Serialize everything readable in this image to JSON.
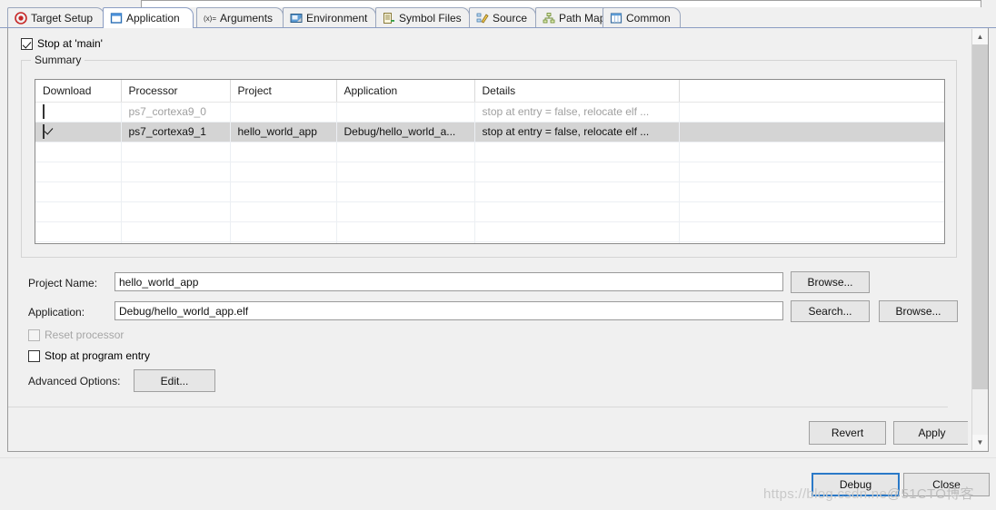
{
  "tabs": [
    {
      "label": "Target Setup",
      "icon": "target-icon",
      "active": false
    },
    {
      "label": "Application",
      "icon": "window-icon",
      "active": true
    },
    {
      "label": "Arguments",
      "icon": "variable-icon",
      "active": false
    },
    {
      "label": "Environment",
      "icon": "environment-icon",
      "active": false
    },
    {
      "label": "Symbol Files",
      "icon": "symbol-files-icon",
      "active": false
    },
    {
      "label": "Source",
      "icon": "source-icon",
      "active": false
    },
    {
      "label": "Path Map",
      "icon": "path-map-icon",
      "active": false
    },
    {
      "label": "Common",
      "icon": "common-icon",
      "active": false
    }
  ],
  "stop_at_main": {
    "label": "Stop at 'main'",
    "checked": true
  },
  "summary": {
    "title": "Summary",
    "columns": [
      "Download",
      "Processor",
      "Project",
      "Application",
      "Details",
      ""
    ],
    "rows": [
      {
        "download": false,
        "processor": "ps7_cortexa9_0",
        "project": "",
        "application": "",
        "details": "stop at entry = false, relocate elf ...",
        "enabled": false,
        "selected": false
      },
      {
        "download": true,
        "processor": "ps7_cortexa9_1",
        "project": "hello_world_app",
        "application": "Debug/hello_world_a...",
        "details": "stop at entry = false, relocate elf ...",
        "enabled": true,
        "selected": true
      }
    ],
    "empty_rows": 7
  },
  "form": {
    "project_name_label": "Project Name:",
    "project_name_value": "hello_world_app",
    "project_name_placeholder": "",
    "project_browse_label": "Browse...",
    "application_label": "Application:",
    "application_value": "Debug/hello_world_app.elf",
    "application_placeholder": "",
    "application_search_label": "Search...",
    "application_browse_label": "Browse...",
    "reset_processor_label": "Reset processor",
    "reset_processor_checked": false,
    "reset_processor_enabled": false,
    "stop_at_entry_label": "Stop at program entry",
    "stop_at_entry_checked": false,
    "advanced_options_label": "Advanced Options:",
    "advanced_edit_label": "Edit..."
  },
  "actions": {
    "revert_label": "Revert",
    "apply_label": "Apply",
    "debug_label": "Debug",
    "close_label": "Close"
  },
  "watermark": {
    "text_a": "https://blog.csdn.ne",
    "text_b": "@51CTO博客"
  },
  "colors": {
    "accent": "#2a79c8",
    "selection": "#d4d4d4",
    "disabled_text": "#a0a0a0",
    "panel_bg": "#f0f0f0",
    "tab_border": "#8b9dc3"
  }
}
